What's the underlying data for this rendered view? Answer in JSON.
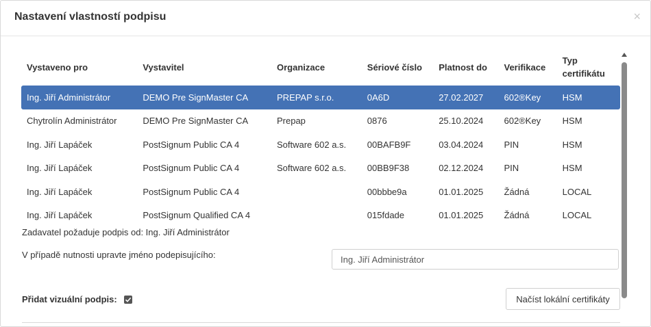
{
  "dialog": {
    "title": "Nastavení vlastností podpisu",
    "close_label": "×"
  },
  "table": {
    "headers": [
      "Vystaveno pro",
      "Vystavitel",
      "Organizace",
      "Sériové číslo",
      "Platnost do",
      "Verifikace",
      "Typ certifikátu"
    ],
    "rows": [
      [
        "Ing. Jiří Administrátor",
        "DEMO Pre SignMaster CA",
        "PREPAP s.r.o.",
        "0A6D",
        "27.02.2027",
        "602®Key",
        "HSM"
      ],
      [
        "Chytrolín Administrátor",
        "DEMO Pre SignMaster CA",
        "Prepap",
        "0876",
        "25.10.2024",
        "602®Key",
        "HSM"
      ],
      [
        "Ing. Jiří Lapáček",
        "PostSignum Public CA 4",
        "Software 602 a.s.",
        "00BAFB9F",
        "03.04.2024",
        "PIN",
        "HSM"
      ],
      [
        "Ing. Jiří Lapáček",
        "PostSignum Public CA 4",
        "Software 602 a.s.",
        "00BB9F38",
        "02.12.2024",
        "PIN",
        "HSM"
      ],
      [
        "Ing. Jiří Lapáček",
        "PostSignum Public CA 4",
        "",
        "00bbbe9a",
        "01.01.2025",
        "Žádná",
        "LOCAL"
      ],
      [
        "Ing. Jiří Lapáček",
        "PostSignum Qualified CA 4",
        "",
        "015fdade",
        "01.01.2025",
        "Žádná",
        "LOCAL"
      ]
    ],
    "selected_row": 0
  },
  "form": {
    "requester_text": "Zadavatel požaduje podpis od: Ing. Jiří Administrátor",
    "edit_name_label": "V případě nutnosti upravte jméno podepisujícího:",
    "name_value": "Ing. Jiří Administrátor",
    "visual_signature_label": "Přidat vizuální podpis:",
    "visual_signature_checked": true,
    "load_button_label": "Načíst lokální certifikáty"
  },
  "colors": {
    "selected_row": "#4472b5",
    "scrollbar_thumb": "#8a8a8a"
  }
}
